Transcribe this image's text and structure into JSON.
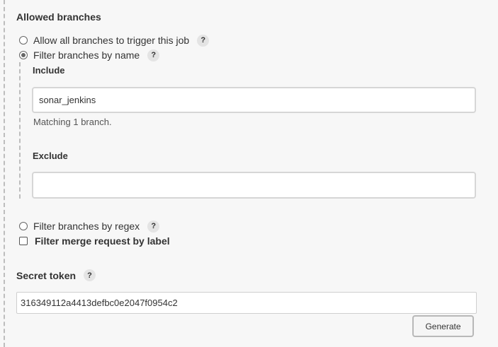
{
  "allowed_branches": {
    "title": "Allowed branches",
    "options": {
      "allow_all": {
        "label": "Allow all branches to trigger this job",
        "checked": false
      },
      "filter_by_name": {
        "label": "Filter branches by name",
        "checked": true
      },
      "filter_by_regex": {
        "label": "Filter branches by regex",
        "checked": false
      }
    },
    "include": {
      "label": "Include",
      "value": "sonar_jenkins",
      "matching_text": "Matching 1 branch."
    },
    "exclude": {
      "label": "Exclude",
      "value": ""
    },
    "merge_request_filter": {
      "label": "Filter merge request by label",
      "checked": false
    }
  },
  "secret_token": {
    "label": "Secret token",
    "value": "316349112a4413defbc0e2047f0954c2",
    "generate_label": "Generate"
  },
  "help": {
    "glyph": "?",
    "icon": "help-icon"
  }
}
